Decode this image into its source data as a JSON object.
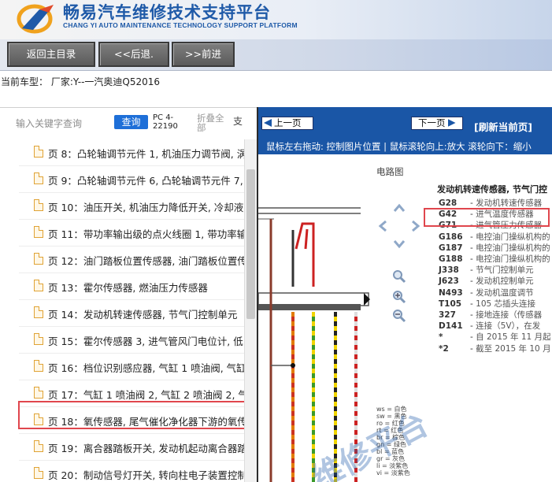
{
  "header": {
    "title_cn": "畅易汽车维修技术支持平台",
    "title_en": "CHANG YI AUTO MAINTENANCE TECHNOLOGY SUPPORT PLATFORM"
  },
  "nav": {
    "home_label": "返回主目录",
    "back_label": "<<后退.",
    "forward_label": ">>前进"
  },
  "current_car": "当前车型： 厂家:Y--一汽奥迪Q52016",
  "left": {
    "search_placeholder": "输入关键字查询",
    "query_label": "查询",
    "pc_code": "PC 4-22190",
    "collapse_label": "折叠全部",
    "support_label": "支",
    "items": [
      "页 8：凸轮轴调节元件 1, 机油压力调节阀, 涡",
      "页 9：凸轮轴调节元件 6, 凸轮轴调节元件 7, 涡",
      "页 10：油压开关, 机油压力降低开关, 冷却液",
      "页 11：带功率输出级的点火线圈 1, 带功率输",
      "页 12：油门踏板位置传感器, 油门踏板位置传",
      "页 13：霍尔传感器, 燃油压力传感器",
      "页 14：发动机转速传感器, 节气门控制单元",
      "页 15：霍尔传感器 3, 进气管风门电位计, 低",
      "页 16：档位识别感应器, 气缸 1 喷油阀, 气缸",
      "页 17：气缸 1 喷油阀 2, 气缸 2 喷油阀 2, 气",
      "页 18：氧传感器, 尾气催化净化器下游的氧传",
      "页 19：离合器踏板开关, 发动机起动离合器踏",
      "页 20：制动信号灯开关, 转向柱电子装置控制"
    ]
  },
  "right": {
    "prev_label": "上一页",
    "next_label": "下一页",
    "refresh_label": "[刷新当前页]",
    "hint_text": "鼠标左右拖动: 控制图片位置 | 鼠标滚轮向上:放大  滚轮向下：缩小",
    "diagram_title": "电路图",
    "legend_head": "发动机转速传感器, 节气门控",
    "legend": [
      {
        "code": "G28",
        "desc": "发动机转速传感器"
      },
      {
        "code": "G42",
        "desc": "进气温度传感器"
      },
      {
        "code": "G71",
        "desc": "进气管压力传感器"
      },
      {
        "code": "G186",
        "desc": "电控油门操纵机构的"
      },
      {
        "code": "G187",
        "desc": "电控油门操纵机构的"
      },
      {
        "code": "G188",
        "desc": "电控油门操纵机构的"
      },
      {
        "code": "J338",
        "desc": "节气门控制单元"
      },
      {
        "code": "J623",
        "desc": "发动机控制单元"
      },
      {
        "code": "N493",
        "desc": "发动机温度调节"
      },
      {
        "code": "T105",
        "desc": "105 芯插头连接"
      },
      {
        "code": "327",
        "desc": "接地连接（传感器"
      },
      {
        "code": "D141",
        "desc": "连接（5V），在发"
      },
      {
        "code": "*",
        "desc": "自 2015 年 11 月起"
      },
      {
        "code": "*2",
        "desc": "截至 2015 年 10 月"
      }
    ],
    "color_key": [
      "ws = 白色",
      "sw = 黑色",
      "ro = 红色",
      "rt = 红色",
      "br = 棕色",
      "gn = 绿色",
      "bl = 蓝色",
      "gr = 灰色",
      "li = 淡紫色",
      "vi = 淡紫色"
    ],
    "watermark": "维修平台"
  }
}
